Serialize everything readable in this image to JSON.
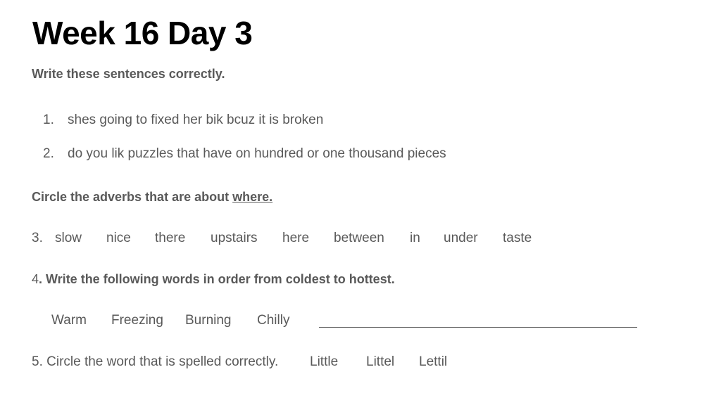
{
  "title": "Week 16 Day 3",
  "section1": {
    "instruction": "Write these sentences correctly.",
    "items": [
      {
        "number": "1.",
        "text": "shes going to fixed her bik bcuz it is broken"
      },
      {
        "number": "2.",
        "text": "do you lik puzzles that have on hundred or one thousand pieces"
      }
    ]
  },
  "section2": {
    "instruction_prefix": "Circle the adverbs that are about ",
    "instruction_emphasis": "where.",
    "number": "3.",
    "words": [
      "slow",
      "nice",
      "there",
      "upstairs",
      "here",
      "between",
      "in",
      "under",
      "taste"
    ]
  },
  "section3": {
    "number": "4",
    "instruction": ". Write the following words in order from coldest to hottest.",
    "words": [
      "Warm",
      "Freezing",
      "Burning",
      "Chilly"
    ]
  },
  "section4": {
    "prompt": "5. Circle the word that is spelled correctly.",
    "options": [
      "Little",
      "Littel",
      "Lettil"
    ]
  }
}
